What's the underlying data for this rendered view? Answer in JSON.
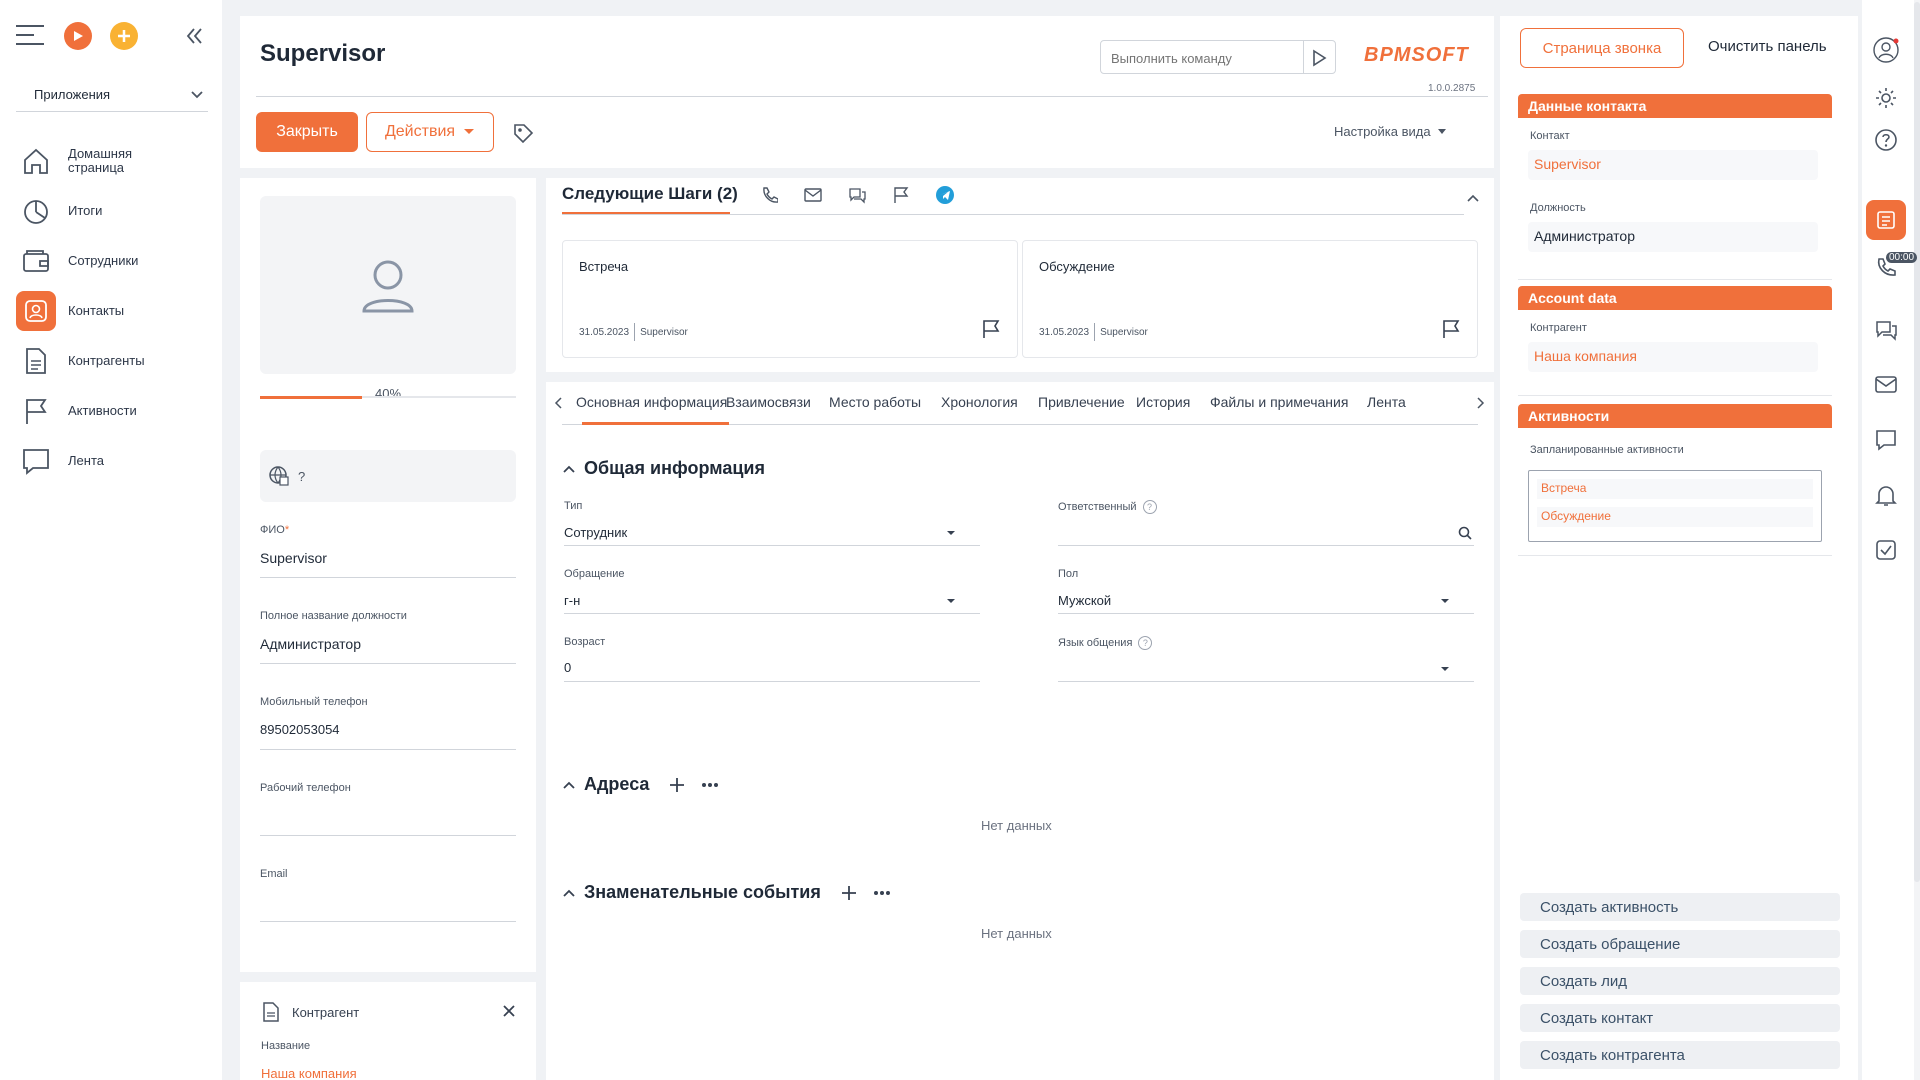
{
  "app": {
    "apps_label": "Приложения",
    "nav": [
      {
        "label": "Домашняя страница",
        "icon": "home-icon"
      },
      {
        "label": "Итоги",
        "icon": "pie-chart-icon"
      },
      {
        "label": "Сотрудники",
        "icon": "wallet-icon"
      },
      {
        "label": "Контакты",
        "icon": "contact-icon"
      },
      {
        "label": "Контрагенты",
        "icon": "document-icon"
      },
      {
        "label": "Активности",
        "icon": "flag-icon"
      },
      {
        "label": "Лента",
        "icon": "chat-icon"
      }
    ],
    "colors": {
      "accent": "#f0703b",
      "link": "#f0703b"
    }
  },
  "header": {
    "title": "Supervisor",
    "command_placeholder": "Выполнить команду",
    "logo_text": "BPMSOFT",
    "version": "1.0.0.2875",
    "close_label": "Закрыть",
    "actions_label": "Действия",
    "view_settings_label": "Настройка вида"
  },
  "profile": {
    "completeness": "40%",
    "completeness_value": 0.4,
    "location_text": "?",
    "fields": [
      {
        "label": "ФИО",
        "required": "*",
        "value": "Supervisor"
      },
      {
        "label": "Полное название должности",
        "value": "Администратор"
      },
      {
        "label": "Мобильный телефон",
        "value": "89502053054"
      },
      {
        "label": "Рабочий телефон",
        "value": ""
      },
      {
        "label": "Email",
        "value": ""
      }
    ],
    "account_card": {
      "title": "Контрагент",
      "name_label": "Название",
      "name_value": "Наша компания"
    }
  },
  "next_steps": {
    "title": "Следующие Шаги (2)",
    "items": [
      {
        "title": "Встреча",
        "date": "31.05.2023",
        "owner": "Supervisor"
      },
      {
        "title": "Обсуждение",
        "date": "31.05.2023",
        "owner": "Supervisor"
      }
    ]
  },
  "tabs": [
    "Основная информация",
    "Взаимосвязи",
    "Место работы",
    "Хронология",
    "Привлечение",
    "История",
    "Файлы и примечания",
    "Лента"
  ],
  "general": {
    "title": "Общая информация",
    "type_label": "Тип",
    "type_value": "Сотрудник",
    "owner_label": "Ответственный",
    "owner_value": "",
    "salutation_label": "Обращение",
    "salutation_value": "г-н",
    "gender_label": "Пол",
    "gender_value": "Мужской",
    "age_label": "Возраст",
    "age_value": "0",
    "language_label": "Язык общения",
    "language_value": ""
  },
  "addresses": {
    "title": "Адреса",
    "empty": "Нет данных"
  },
  "events": {
    "title": "Знаменательные события",
    "empty": "Нет данных"
  },
  "right_panel": {
    "call_page_label": "Страница звонка",
    "clear_panel_label": "Очистить панель",
    "contact_data": {
      "title": "Данные контакта",
      "contact_label": "Контакт",
      "contact_value": "Supervisor",
      "position_label": "Должность",
      "position_value": "Администратор"
    },
    "account_data": {
      "title": "Account data",
      "account_label": "Контрагент",
      "account_value": "Наша компания"
    },
    "activities": {
      "title": "Активности",
      "planned_label": "Запланированные активности",
      "items": [
        "Встреча",
        "Обсуждение"
      ]
    },
    "quick_actions": [
      "Создать активность",
      "Создать обращение",
      "Создать лид",
      "Создать контакт",
      "Создать контрагента"
    ],
    "timer": "00:00"
  }
}
